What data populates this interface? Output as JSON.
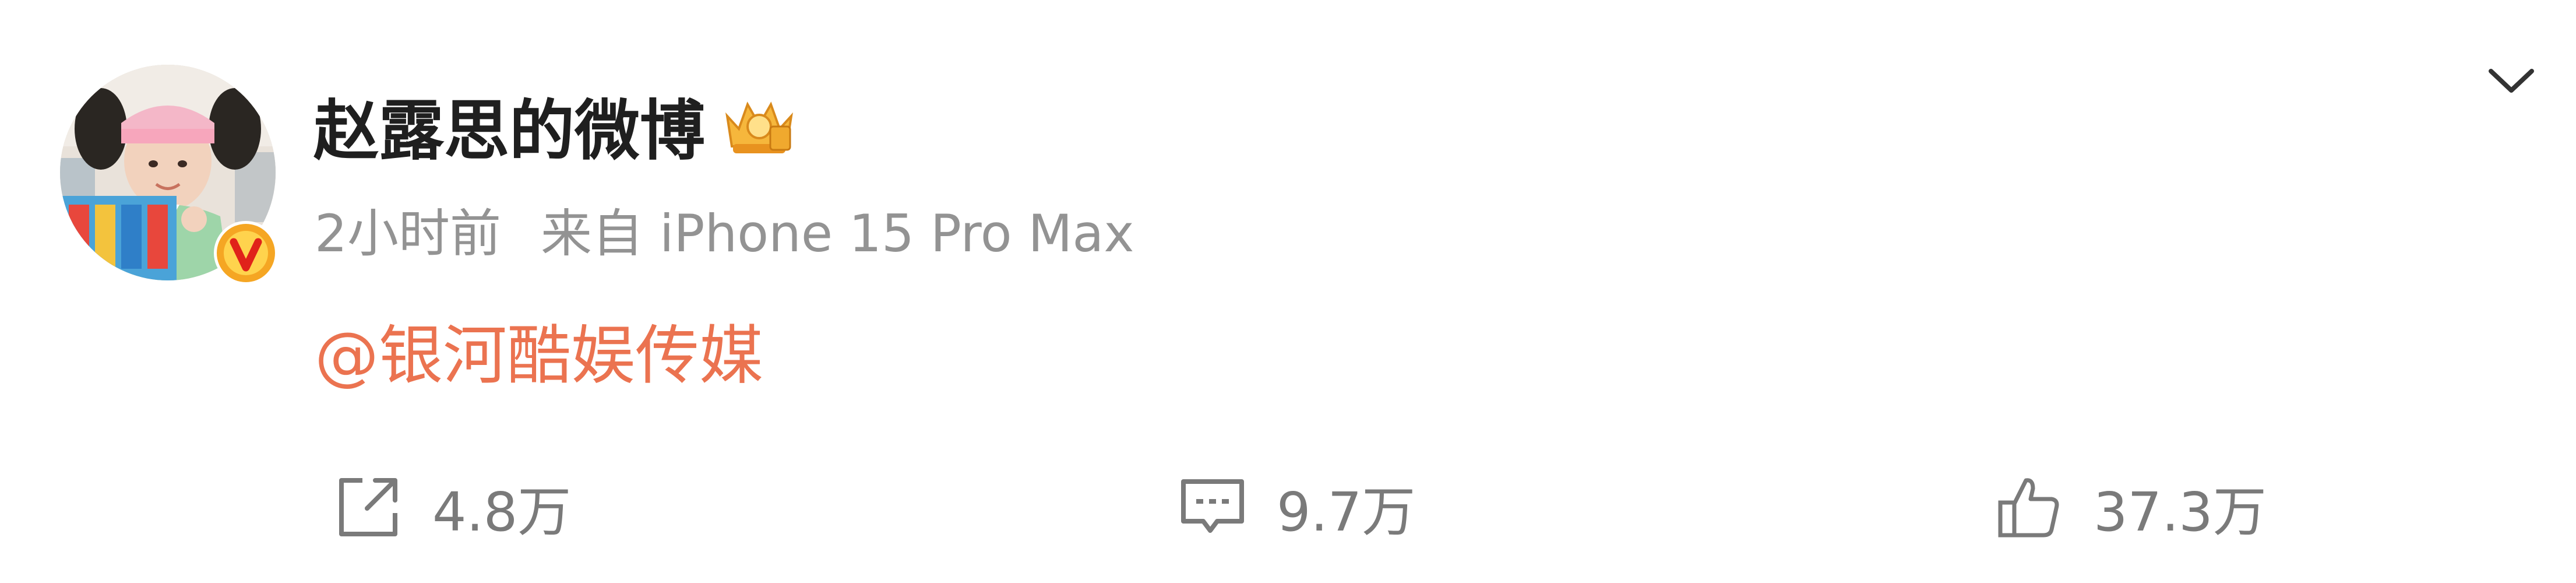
{
  "post": {
    "author": "赵露思的微博",
    "time": "2小时前",
    "source": "来自 iPhone 15 Pro Max",
    "mention": "@银河酷娱传媒",
    "badge_letter": "V"
  },
  "actions": {
    "repost_count": "4.8万",
    "comment_count": "9.7万",
    "like_count": "37.3万"
  },
  "colors": {
    "mention": "#eb7350",
    "meta": "#939393",
    "badge": "#f5a623",
    "badge_inner": "#e0221a"
  },
  "icons": [
    "avatar-image",
    "verified-v-icon",
    "vip-crown-icon",
    "chevron-down-icon",
    "repost-icon",
    "comment-icon",
    "like-icon"
  ]
}
